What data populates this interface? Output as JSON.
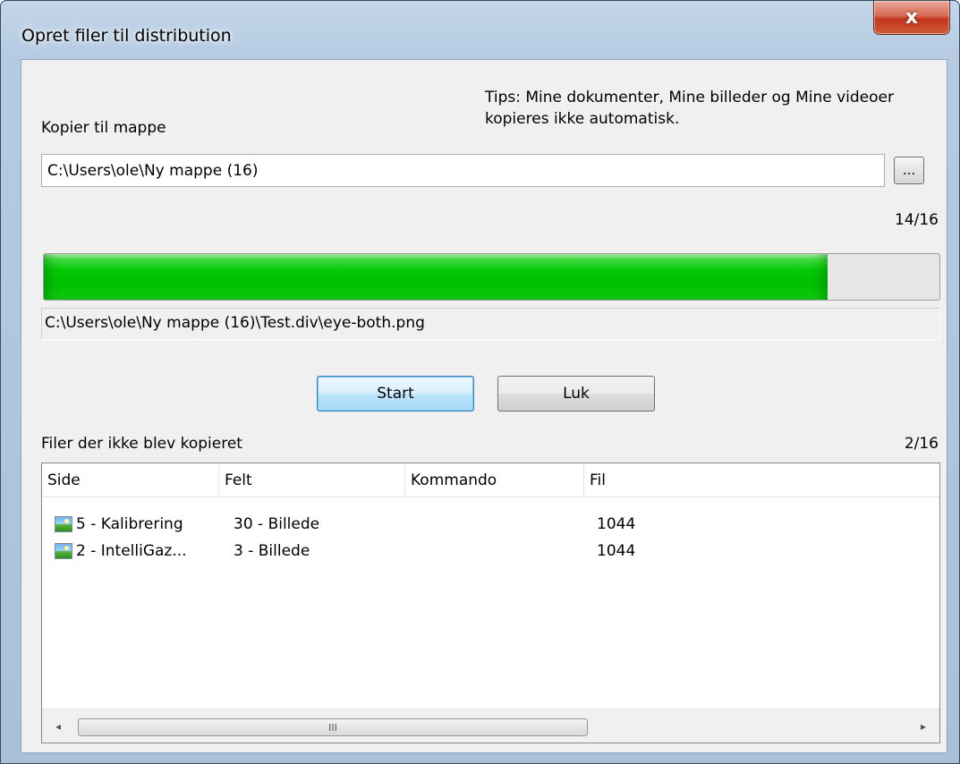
{
  "window": {
    "title": "Opret filer til distribution",
    "close_glyph": "x"
  },
  "tips": "Tips: Mine dokumenter, Mine billeder og Mine videoer kopieres ikke automatisk.",
  "destination": {
    "label": "Kopier til mappe",
    "value": "C:\\Users\\ole\\Ny mappe (16)",
    "browse_label": "..."
  },
  "progress": {
    "count_text": "14/16",
    "fraction": 0.875,
    "color": "#00c000",
    "current_file": "C:\\Users\\ole\\Ny mappe (16)\\Test.div\\eye-both.png"
  },
  "buttons": {
    "start": "Start",
    "close": "Luk"
  },
  "not_copied": {
    "label": "Filer der ikke blev kopieret",
    "count_text": "2/16",
    "columns": [
      "Side",
      "Felt",
      "Kommando",
      "Fil"
    ],
    "rows": [
      {
        "icon": "image-icon",
        "side": "5 - Kalibrering",
        "felt": "30 - Billede",
        "kommando": "",
        "fil": "1044"
      },
      {
        "icon": "image-icon",
        "side": "2 - IntelliGaz...",
        "felt": "3 - Billede",
        "kommando": "",
        "fil": "1044"
      }
    ]
  },
  "scrollbar": {
    "left_arrow": "◂",
    "right_arrow": "▸",
    "grip": "III"
  }
}
